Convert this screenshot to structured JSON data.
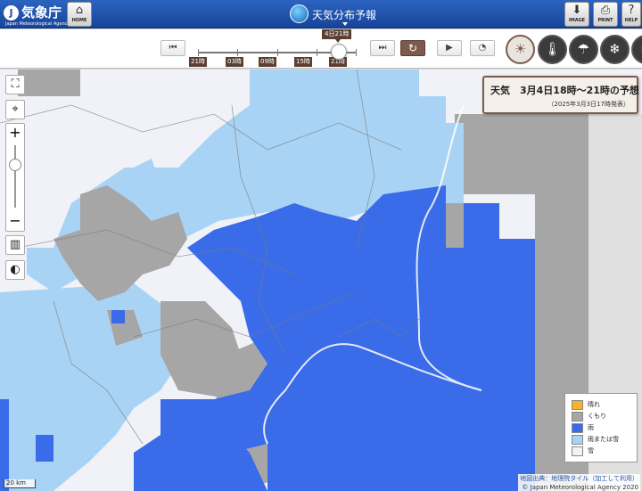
{
  "header": {
    "logo_mark": "JMA",
    "logo_name": "気象庁",
    "logo_sub": "Japan Meteorological Agency",
    "title": "天気分布予報",
    "home_label": "HOME",
    "image_label": "IMAGE",
    "print_label": "PRINT",
    "help_label": "HELP"
  },
  "time_control": {
    "current_time": "4日21時",
    "ticks": [
      "21時",
      "03時",
      "09時",
      "15時",
      "21時"
    ]
  },
  "elements": {
    "weather": "weather-icon",
    "temperature": "thermometer-icon",
    "precipitation": "rain-cloud-icon",
    "snow": "snow-cloud-icon"
  },
  "info_panel": {
    "title": "天気　3月4日18時～21時の予想",
    "issued": "（2025年3月3日17時発表）"
  },
  "legend": {
    "items": [
      {
        "label": "晴れ",
        "color": "#f7b32b"
      },
      {
        "label": "くもり",
        "color": "#a6a6a6"
      },
      {
        "label": "雨",
        "color": "#3a6be8"
      },
      {
        "label": "雨または雪",
        "color": "#a9d3f5"
      },
      {
        "label": "雪",
        "color": "#f0f2f8"
      }
    ]
  },
  "map": {
    "scale_label": "20 km",
    "attribution_tiles": "地図出典：地理院タイル（加工して利用）",
    "attribution_copy": "© Japan Meteorological Agency 2020"
  },
  "colors": {
    "header_blue": "#1f55b0",
    "accent_brown": "#7a5b4c",
    "rain": "#3a6be8",
    "rain_or_snow": "#a9d3f5",
    "cloudy": "#a6a6a6",
    "snow": "#f0f2f8"
  }
}
